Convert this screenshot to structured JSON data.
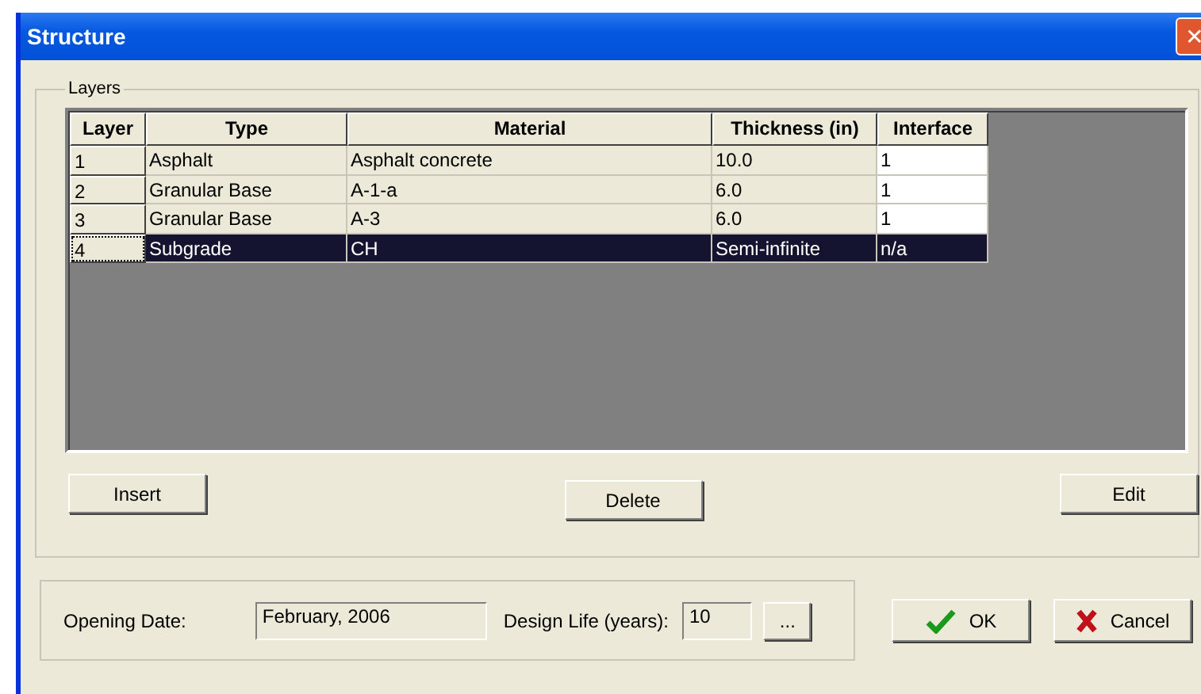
{
  "window": {
    "title": "Structure",
    "close": "✕"
  },
  "layers_group": {
    "title": "Layers",
    "table": {
      "columns": [
        "Layer",
        "Type",
        "Material",
        "Thickness (in)",
        "Interface"
      ],
      "rows": [
        {
          "cells": [
            "1",
            "Asphalt",
            "Asphalt concrete",
            "10.0",
            "1"
          ],
          "selected": false
        },
        {
          "cells": [
            "2",
            "Granular Base",
            "A-1-a",
            "6.0",
            "1"
          ],
          "selected": false
        },
        {
          "cells": [
            "3",
            "Granular Base",
            "A-3",
            "6.0",
            "1"
          ],
          "selected": false
        },
        {
          "cells": [
            "4",
            "Subgrade",
            "CH",
            "Semi-infinite",
            "n/a"
          ],
          "selected": true
        }
      ]
    },
    "buttons": [
      "Insert",
      "Delete",
      "Edit"
    ]
  },
  "opening_date": {
    "label": "Opening Date:",
    "value": "February, 2006"
  },
  "design_life": {
    "label": "Design Life (years):",
    "value": "10",
    "browse": "..."
  },
  "ok": "OK",
  "cancel": "Cancel"
}
